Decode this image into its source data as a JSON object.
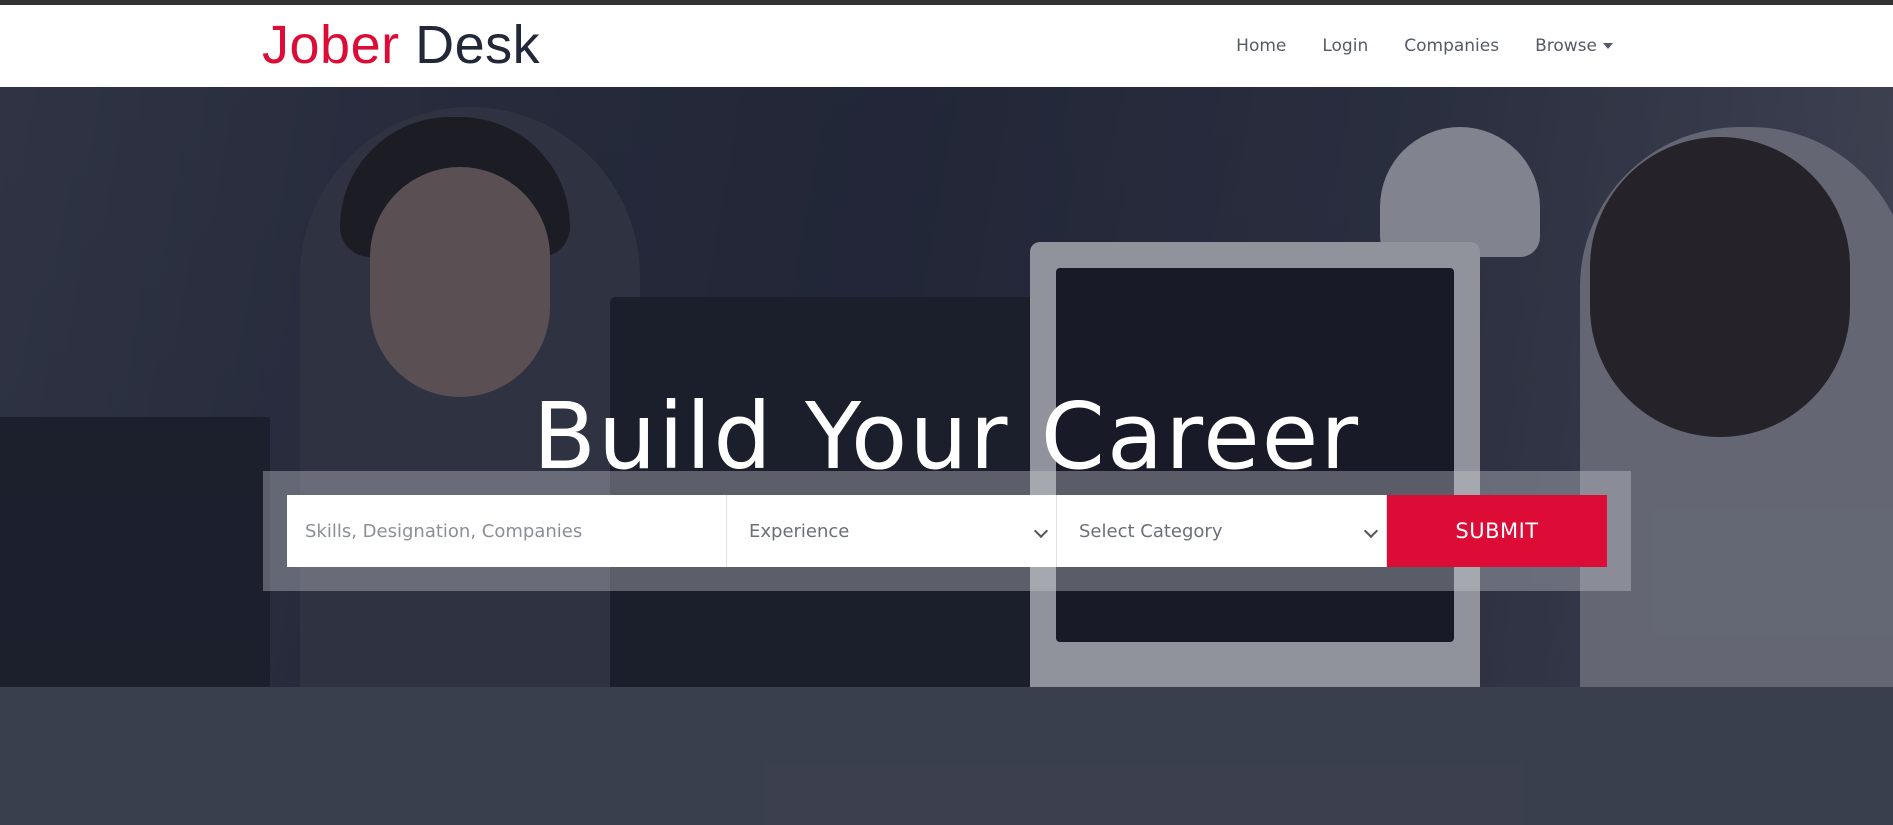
{
  "brand": {
    "part1": "Jober",
    "part2": "Desk",
    "accent": "#dc0c37",
    "dark": "#232838"
  },
  "nav": {
    "items": [
      {
        "label": "Home"
      },
      {
        "label": "Login"
      },
      {
        "label": "Companies"
      },
      {
        "label": "Browse",
        "icon": "caret-down-icon"
      }
    ]
  },
  "hero": {
    "headline": "Build Your Career",
    "search": {
      "keywords_placeholder": "Skills, Designation, Companies",
      "experience_selected": "Experience",
      "category_selected": "Select Category",
      "submit_label": "SUBMIT"
    }
  }
}
